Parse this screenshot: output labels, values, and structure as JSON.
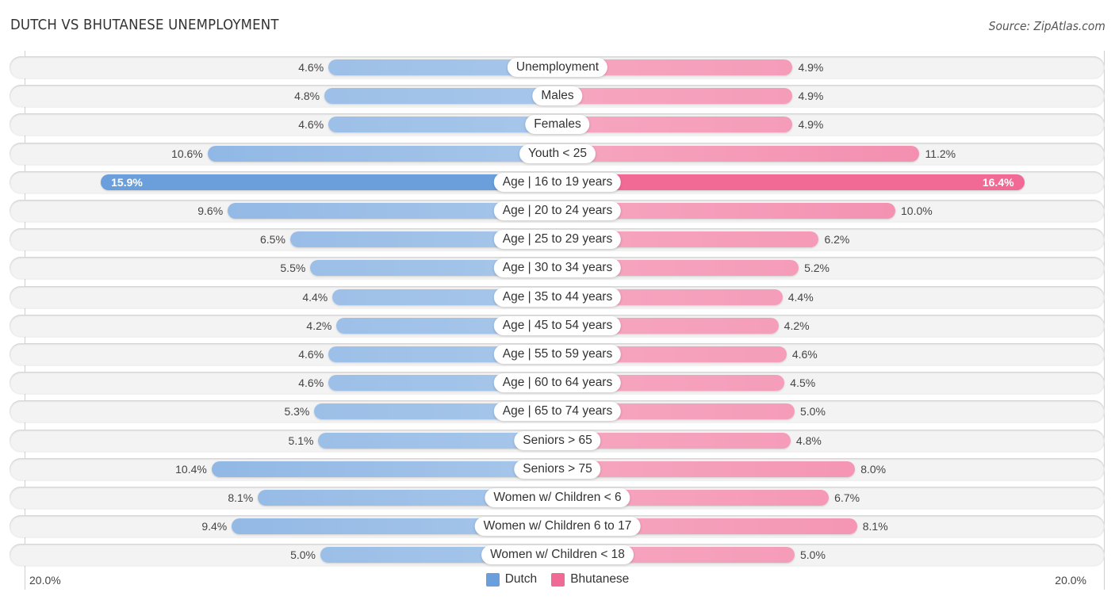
{
  "header": {
    "title": "DUTCH VS BHUTANESE UNEMPLOYMENT",
    "source": "Source: ZipAtlas.com"
  },
  "colors": {
    "dutch": "#a7c6ea",
    "dutch_strong": "#6a9fdc",
    "bhutanese": "#f6a6c0",
    "bhutanese_strong": "#f06a95",
    "row_bg": "#f3f3f3"
  },
  "legend": {
    "items": [
      {
        "label": "Dutch",
        "color": "#6a9fdc"
      },
      {
        "label": "Bhutanese",
        "color": "#f06a95"
      }
    ]
  },
  "axis": {
    "left_label": "20.0%",
    "right_label": "20.0%"
  },
  "chart_data": {
    "type": "bar",
    "orientation": "horizontal-diverging",
    "title": "DUTCH VS BHUTANESE UNEMPLOYMENT",
    "xlabel": "",
    "ylabel": "",
    "xlim": [
      -20,
      20
    ],
    "unit": "%",
    "legend_position": "bottom-center",
    "categories": [
      "Unemployment",
      "Males",
      "Females",
      "Youth < 25",
      "Age | 16 to 19 years",
      "Age | 20 to 24 years",
      "Age | 25 to 29 years",
      "Age | 30 to 34 years",
      "Age | 35 to 44 years",
      "Age | 45 to 54 years",
      "Age | 55 to 59 years",
      "Age | 60 to 64 years",
      "Age | 65 to 74 years",
      "Seniors > 65",
      "Seniors > 75",
      "Women w/ Children < 6",
      "Women w/ Children 6 to 17",
      "Women w/ Children < 18"
    ],
    "series": [
      {
        "name": "Dutch",
        "side": "left",
        "values": [
          4.6,
          4.8,
          4.6,
          10.6,
          15.9,
          9.6,
          6.5,
          5.5,
          4.4,
          4.2,
          4.6,
          4.6,
          5.3,
          5.1,
          10.4,
          8.1,
          9.4,
          5.0
        ],
        "labels": [
          "4.6%",
          "4.8%",
          "4.6%",
          "10.6%",
          "15.9%",
          "9.6%",
          "6.5%",
          "5.5%",
          "4.4%",
          "4.2%",
          "4.6%",
          "4.6%",
          "5.3%",
          "5.1%",
          "10.4%",
          "8.1%",
          "9.4%",
          "5.0%"
        ]
      },
      {
        "name": "Bhutanese",
        "side": "right",
        "values": [
          4.9,
          4.9,
          4.9,
          11.2,
          16.4,
          10.0,
          6.2,
          5.2,
          4.4,
          4.2,
          4.6,
          4.5,
          5.0,
          4.8,
          8.0,
          6.7,
          8.1,
          5.0
        ],
        "labels": [
          "4.9%",
          "4.9%",
          "4.9%",
          "11.2%",
          "16.4%",
          "10.0%",
          "6.2%",
          "5.2%",
          "4.4%",
          "4.2%",
          "4.6%",
          "4.5%",
          "5.0%",
          "4.8%",
          "8.0%",
          "6.7%",
          "8.1%",
          "5.0%"
        ]
      }
    ],
    "highlighted_category": "Age | 16 to 19 years"
  }
}
